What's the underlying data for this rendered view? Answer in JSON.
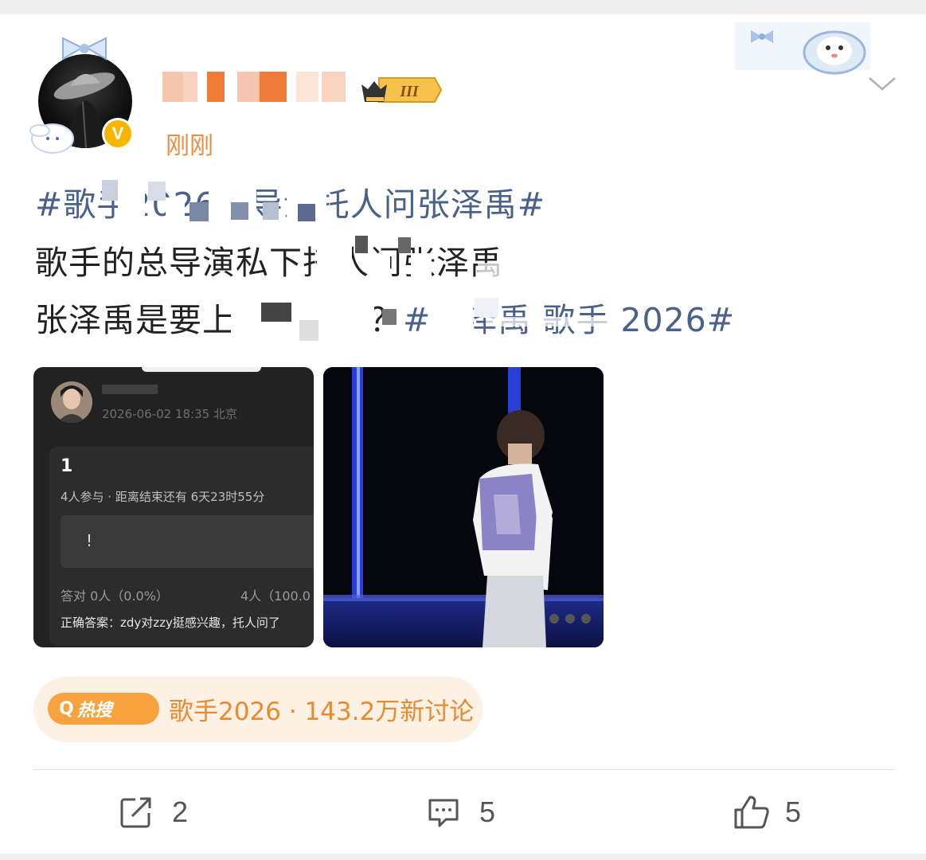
{
  "post": {
    "username": "",
    "time": "刚刚",
    "verified_badge": "V",
    "level_badge": "III",
    "lines": [
      {
        "text": "#歌手2026总导演托人问张泽禹#",
        "style": "tag"
      },
      {
        "text": "歌手的总导演私下托人问张泽禹",
        "style": "normal"
      },
      {
        "text": "张泽禹是要上歌手了吗？",
        "tag_suffix": "#张泽禹 歌手 2026#"
      }
    ]
  },
  "images": [
    {
      "alt": "quiz-screenshot",
      "time_location": "2026-06-02 18:35 北京",
      "quiz_number": "1",
      "participants": "4人参与 · 距离结束还有 6天23时55分",
      "option_text": "!",
      "stats_left": "答对  0人（0.0%）",
      "stats_right": "4人（100.0",
      "answer": "正确答案：zdy对zzy挺感兴趣，托人问了"
    },
    {
      "alt": "stage-performance-photo"
    }
  ],
  "hot_search": {
    "badge_icon": "Q",
    "badge_label": "热搜",
    "text": "歌手2026 · 143.2万新讨论"
  },
  "actions": {
    "repost_count": "2",
    "comment_count": "5",
    "like_count": "5"
  },
  "icons": {
    "menu": "chevron-down-icon",
    "repost": "share-icon",
    "comment": "comment-icon",
    "like": "thumbs-up-icon"
  },
  "colors": {
    "tag_blue": "#4a6189",
    "time_orange": "#f08a3c",
    "hot_orange": "#e88a2d",
    "hot_badge": "#f7a23f",
    "verified_gold": "#f7b500"
  }
}
